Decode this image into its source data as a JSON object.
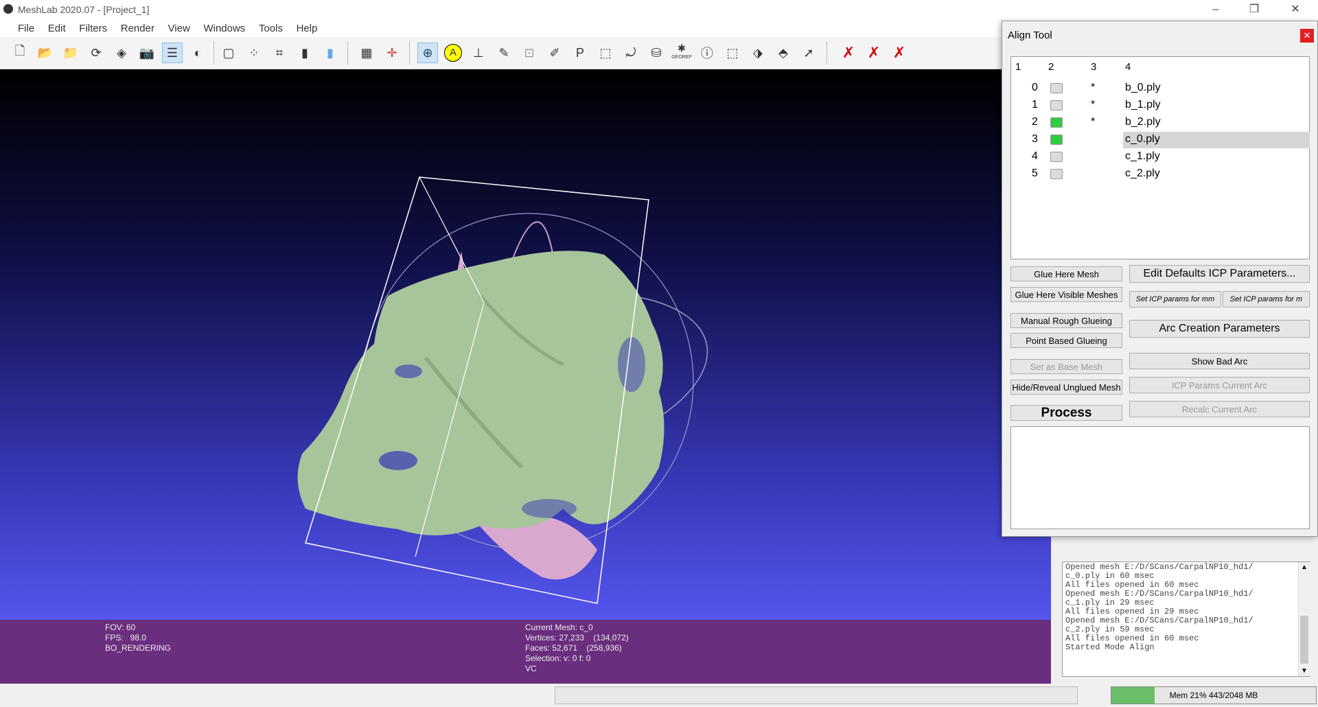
{
  "window": {
    "title": "MeshLab 2020.07 - [Project_1]"
  },
  "menu": [
    "File",
    "Edit",
    "Filters",
    "Render",
    "View",
    "Windows",
    "Tools",
    "Help"
  ],
  "toolbar": {
    "icons": [
      "new-file-icon",
      "open-project-icon",
      "open-folder-icon",
      "reload-icon",
      "save-icon",
      "snapshot-icon",
      "layers-icon",
      "shading-icon",
      "bbox-icon",
      "points-icon",
      "wireframe-icon",
      "flat-icon",
      "smooth-icon",
      "grid-icon",
      "axis-icon",
      "trackball-icon",
      "annotation-icon",
      "measure-icon",
      "paint-icon",
      "texture-icon",
      "brush-icon",
      "parametrization-icon",
      "select-icon",
      "rotate-icon",
      "stack-icon",
      "georef-icon",
      "info-icon",
      "select-faces-icon",
      "select-vertices-icon",
      "select-connected-icon",
      "arrow-icon",
      "delete-faces-icon",
      "delete-vertices-icon",
      "delete-all-icon"
    ],
    "georef_label": "GEOREF"
  },
  "viewport_info": {
    "left": [
      "FOV: 60",
      "FPS:   98.0",
      "BO_RENDERING"
    ],
    "right": [
      "Current Mesh: c_0",
      "Vertices: 27,233    (134,072)",
      "Faces: 52,671    (258,936)",
      "Selection: v: 0 f: 0",
      "VC"
    ]
  },
  "align_tool": {
    "title": "Align Tool",
    "close_label": "✕",
    "columns": [
      "1",
      "2",
      "3",
      "4"
    ],
    "rows": [
      {
        "id": "0",
        "visible": false,
        "star": "*",
        "file": "b_0.ply"
      },
      {
        "id": "1",
        "visible": false,
        "star": "*",
        "file": "b_1.ply"
      },
      {
        "id": "2",
        "visible": true,
        "star": "*",
        "file": "b_2.ply"
      },
      {
        "id": "3",
        "visible": true,
        "star": "",
        "file": "c_0.ply"
      },
      {
        "id": "4",
        "visible": false,
        "star": "",
        "file": "c_1.ply"
      },
      {
        "id": "5",
        "visible": false,
        "star": "",
        "file": "c_2.ply"
      }
    ],
    "selected_row": "3",
    "buttons": {
      "glue_here": "Glue Here Mesh",
      "glue_visible": "Glue Here Visible Meshes",
      "manual_rough": "Manual Rough Glueing",
      "point_based": "Point Based Glueing",
      "set_base": "Set as Base Mesh",
      "hide_reveal": "Hide/Reveal Unglued Mesh",
      "process": "Process",
      "edit_icp": "Edit Defaults ICP Parameters...",
      "icp_mm": "Set ICP params for mm",
      "icp_m": "Set ICP params for m",
      "arc_creation": "Arc Creation Parameters",
      "show_bad_arc": "Show Bad Arc",
      "icp_current": "ICP Params Current Arc",
      "recalc": "Recalc Current Arc"
    }
  },
  "log": [
    "Opened mesh E:/D/SCans/CarpalNP10_hd1/",
    "c_0.ply in 60 msec",
    "All files opened in 60 msec",
    "Opened mesh E:/D/SCans/CarpalNP10_hd1/",
    "c_1.ply in 29 msec",
    "All files opened in 29 msec",
    "Opened mesh E:/D/SCans/CarpalNP10_hd1/",
    "c_2.ply in 59 msec",
    "All files opened in 60 msec",
    "Started Mode Align"
  ],
  "memory": {
    "label": "Mem 21% 443/2048 MB",
    "fraction": 0.21
  },
  "colors": {
    "mesh_green": "#a8c49a",
    "mesh_pink": "#d9a8cf",
    "info_purple": "#6a2e7e",
    "mem_green": "#6bbf6b"
  }
}
